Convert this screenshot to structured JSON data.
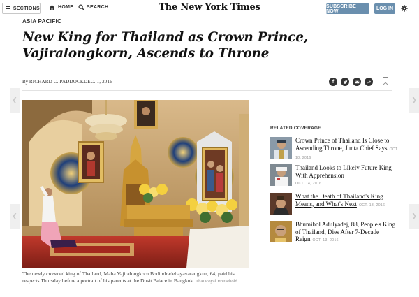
{
  "nav": {
    "sections_label": "SECTIONS",
    "home_label": "HOME",
    "search_label": "SEARCH",
    "masthead": "The New York Times",
    "subscribe_label": "SUBSCRIBE NOW",
    "login_label": "LOG IN",
    "accent_color": "#6a8fae"
  },
  "article": {
    "kicker": "ASIA PACIFIC",
    "headline_line1": "New King for Thailand as Crown Prince,",
    "headline_line2": "Vajiralongkorn, Ascends to Throne",
    "byline_prefix": "By ",
    "author": "RICHARD C. PADDOCK",
    "date": "DEC. 1, 2016",
    "share_icons": [
      "facebook-icon",
      "twitter-icon",
      "email-icon",
      "share-icon"
    ],
    "caption": "The newly crowned king of Thailand, Maha Vajiralongkorn Bodindradebayavarangkun, 64, paid his respects Thursday before a portrait of his parents at the Dusit Palace in Bangkok.",
    "credit": "Thai Royal Household"
  },
  "related": {
    "title": "RELATED COVERAGE",
    "items": [
      {
        "title": "Crown Prince of Thailand Is Close to Ascending Throne, Junta Chief Says",
        "date": "OCT. 18, 2016"
      },
      {
        "title": "Thailand Looks to Likely Future King With Apprehension",
        "date": "OCT. 14, 2016"
      },
      {
        "title": "What the Death of Thailand's King Means, and What's Next",
        "date": "OCT. 13, 2016"
      },
      {
        "title": "Bhumibol Adulyadej, 88, People's King of Thailand, Dies After 7-Decade Reign",
        "date": "OCT. 13, 2016"
      }
    ]
  },
  "arrows": {
    "left": "❮",
    "right": "❯"
  }
}
